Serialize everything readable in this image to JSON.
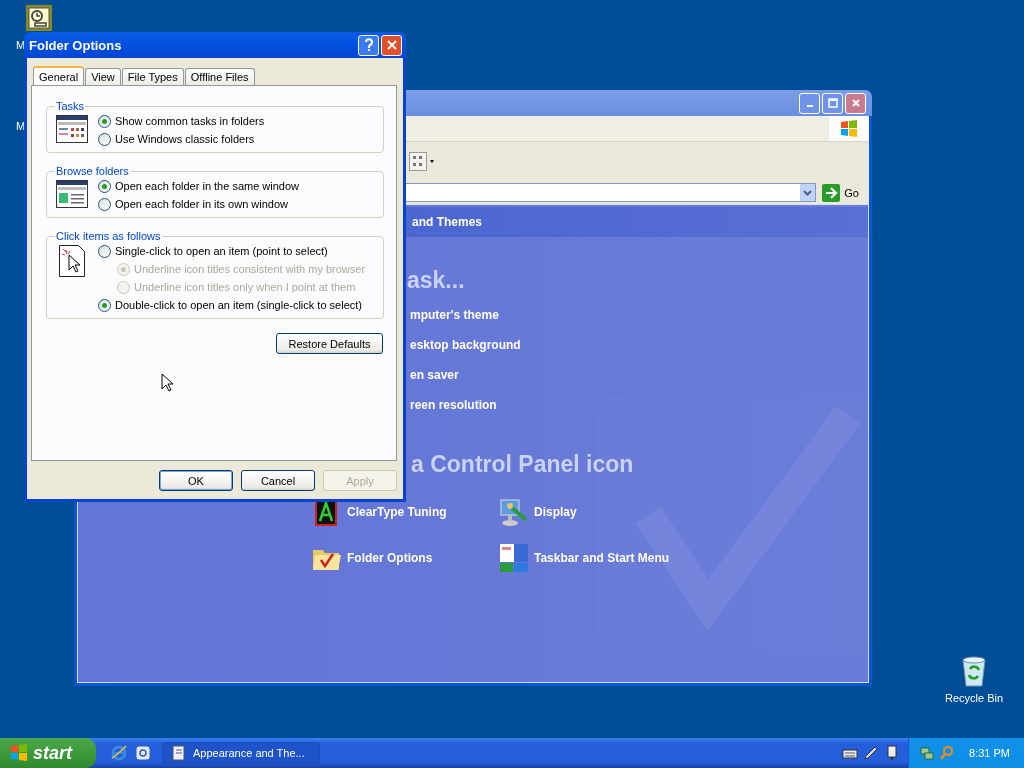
{
  "desktop": {
    "icon_labels": [
      "M",
      "M"
    ],
    "recycle_bin": {
      "label": "Recycle Bin"
    }
  },
  "background_window": {
    "address": {
      "go_label": "Go"
    },
    "header": "and Themes",
    "task_heading": "ask...",
    "tasks": [
      "mputer's theme",
      "esktop background",
      "en saver",
      "reen resolution"
    ],
    "icons_heading": "a Control Panel icon",
    "icons": [
      {
        "label": "ClearType Tuning",
        "kind": "cleartype"
      },
      {
        "label": "Display",
        "kind": "display"
      },
      {
        "label": "Folder Options",
        "kind": "folder"
      },
      {
        "label": "Taskbar and Start Menu",
        "kind": "taskbar"
      }
    ]
  },
  "dialog": {
    "title": "Folder Options",
    "tabs": [
      {
        "label": "General",
        "selected": true
      },
      {
        "label": "View",
        "selected": false
      },
      {
        "label": "File Types",
        "selected": false
      },
      {
        "label": "Offline Files",
        "selected": false
      }
    ],
    "groups": [
      {
        "title": "Tasks",
        "kind": "tasks",
        "options": [
          {
            "label": "Show common tasks in folders",
            "selected": true,
            "disabled": false
          },
          {
            "label": "Use Windows classic folders",
            "selected": false,
            "disabled": false
          }
        ]
      },
      {
        "title": "Browse folders",
        "kind": "browse",
        "options": [
          {
            "label": "Open each folder in the same window",
            "selected": true,
            "disabled": false
          },
          {
            "label": "Open each folder in its own window",
            "selected": false,
            "disabled": false
          }
        ]
      },
      {
        "title": "Click items as follows",
        "kind": "click",
        "options": [
          {
            "label": "Single-click to open an item (point to select)",
            "selected": false,
            "disabled": false,
            "children": [
              {
                "label": "Underline icon titles consistent with my browser",
                "selected": true,
                "disabled": true
              },
              {
                "label": "Underline icon titles only when I point at them",
                "selected": false,
                "disabled": true
              }
            ]
          },
          {
            "label": "Double-click to open an item (single-click to select)",
            "selected": true,
            "disabled": false
          }
        ]
      }
    ],
    "restore_button": "Restore Defaults",
    "buttons": [
      {
        "label": "OK",
        "default": true,
        "disabled": false
      },
      {
        "label": "Cancel",
        "default": false,
        "disabled": false
      },
      {
        "label": "Apply",
        "default": false,
        "disabled": true
      }
    ]
  },
  "taskbar": {
    "start_label": "start",
    "tasks": [
      {
        "label": "Appearance and The..."
      }
    ],
    "clock": "8:31 PM"
  }
}
